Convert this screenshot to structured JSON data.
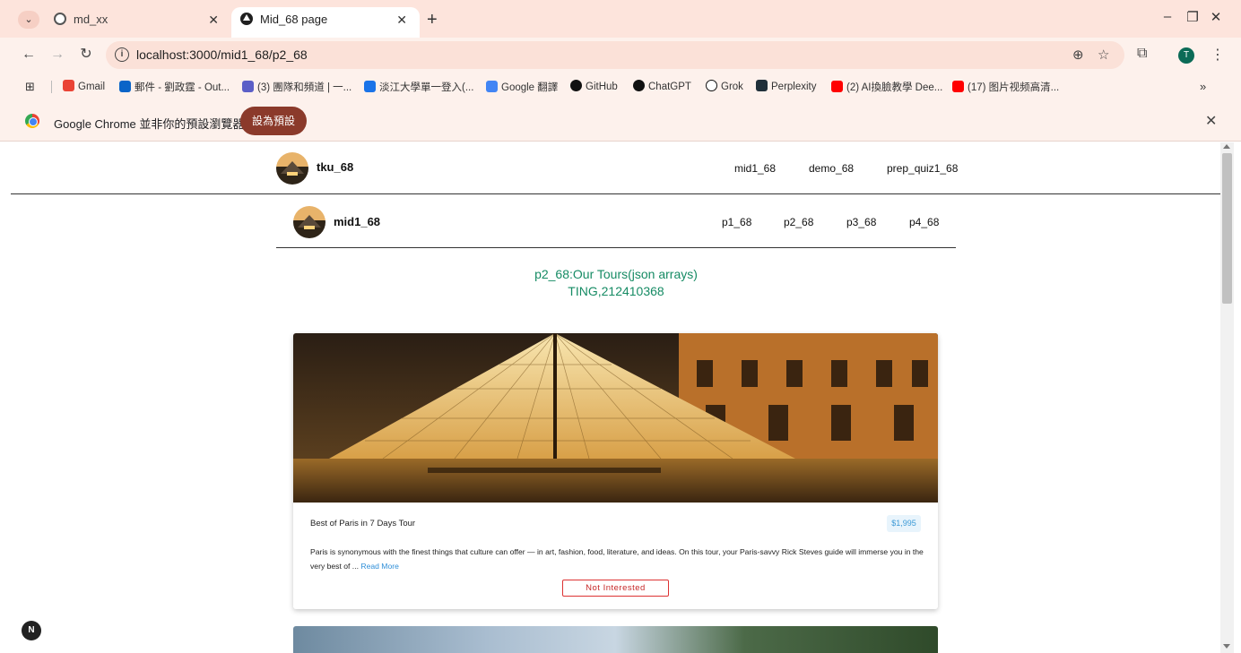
{
  "browser": {
    "tabs": [
      {
        "title": "md_xx",
        "active": false
      },
      {
        "title": "Mid_68 page",
        "active": true
      }
    ],
    "url": "localhost:3000/mid1_68/p2_68",
    "profile_initial": "T",
    "bookmarks": [
      {
        "label": "Gmail",
        "color": "#ea4335"
      },
      {
        "label": "郵件 - 劉政霆 - Out...",
        "color": "#0a64c8"
      },
      {
        "label": "(3) 團隊和頻道 | 一...",
        "color": "#5b5fc7"
      },
      {
        "label": "淡江大學單一登入(...",
        "color": "#1a73e8"
      },
      {
        "label": "Google 翻譯",
        "color": "#4285f4"
      },
      {
        "label": "GitHub",
        "color": "#111111"
      },
      {
        "label": "ChatGPT",
        "color": "#111111"
      },
      {
        "label": "Grok",
        "color": "#111111"
      },
      {
        "label": "Perplexity",
        "color": "#20303a"
      },
      {
        "label": "(2) AI換臉教學 Dee...",
        "color": "#ff0000"
      },
      {
        "label": "(17) 图片视频高清...",
        "color": "#ff0000"
      }
    ],
    "infobar": {
      "message": "Google Chrome 並非你的預設瀏覽器",
      "button": "設為預設"
    }
  },
  "page": {
    "nav1": {
      "brand": "tku_68",
      "links": [
        "mid1_68",
        "demo_68",
        "prep_quiz1_68"
      ]
    },
    "nav2": {
      "brand": "mid1_68",
      "links": [
        "p1_68",
        "p2_68",
        "p3_68",
        "p4_68"
      ]
    },
    "heading": {
      "line1": "p2_68:Our Tours(json arrays)",
      "line2": "TING,212410368"
    },
    "tours": [
      {
        "name": "Best of Paris in 7 Days Tour",
        "price": "$1,995",
        "info": "Paris is synonymous with the finest things that culture can offer — in art, fashion, food, literature, and ideas. On this tour, your Paris-savvy Rick Steves guide will immerse you in the very best of ...",
        "read_more": "Read More",
        "button": "Not Interested"
      }
    ],
    "dev_badge": "N"
  }
}
